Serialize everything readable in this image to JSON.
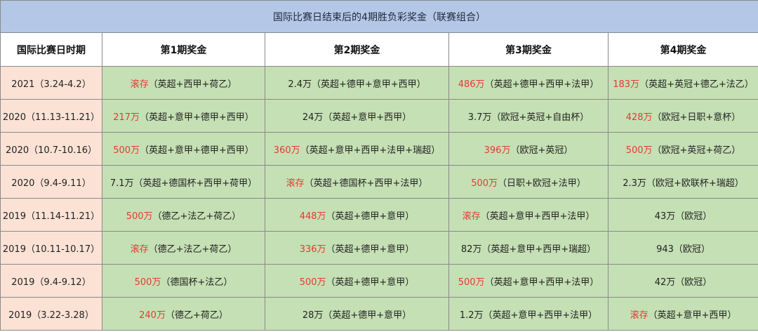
{
  "title": "国际比赛日结束后的4期胜负彩奖金（联赛组合）",
  "headers": [
    "国际比赛日时期",
    "第1期奖金",
    "第2期奖金",
    "第3期奖金",
    "第4期奖金"
  ],
  "highlight_color": "#e53935",
  "rows": [
    {
      "period": "2021（3.24-4.2）",
      "cells": [
        {
          "amount": "滚存",
          "highlight": true,
          "leagues": "（英超+西甲+荷乙）"
        },
        {
          "amount": "2.4万",
          "highlight": false,
          "leagues": "（英超+德甲+意甲+西甲）"
        },
        {
          "amount": "486万",
          "highlight": true,
          "leagues": "（英超+德甲+西甲+法甲）"
        },
        {
          "amount": "183万",
          "highlight": true,
          "leagues": "（英超+英冠+德乙+法乙）"
        }
      ]
    },
    {
      "period": "2020（11.13-11.21）",
      "cells": [
        {
          "amount": "217万",
          "highlight": true,
          "leagues": "（英超+意甲+德甲+西甲）"
        },
        {
          "amount": "24万",
          "highlight": false,
          "leagues": "（英超+意甲+西甲）"
        },
        {
          "amount": "3.7万",
          "highlight": false,
          "leagues": "（欧冠+英冠+自由杯）"
        },
        {
          "amount": "428万",
          "highlight": true,
          "leagues": "（欧冠+日职+意杯）"
        }
      ]
    },
    {
      "period": "2020（10.7-10.16）",
      "cells": [
        {
          "amount": "500万",
          "highlight": true,
          "leagues": "（英超+意甲+德甲+西甲）"
        },
        {
          "amount": "360万",
          "highlight": true,
          "leagues": "（英超+意甲+西甲+法甲+瑞超）"
        },
        {
          "amount": "396万",
          "highlight": true,
          "leagues": "（欧冠+英冠）"
        },
        {
          "amount": "500万",
          "highlight": true,
          "leagues": "（欧冠+英冠+荷乙）"
        }
      ]
    },
    {
      "period": "2020（9.4-9.11）",
      "cells": [
        {
          "amount": "7.1万",
          "highlight": false,
          "leagues": "（英超+德国杯+西甲+荷甲）"
        },
        {
          "amount": "滚存",
          "highlight": true,
          "leagues": "（英超+德国杯+西甲+法甲）"
        },
        {
          "amount": "500万",
          "highlight": true,
          "leagues": "（日职+欧冠+法甲）"
        },
        {
          "amount": "2.3万",
          "highlight": false,
          "leagues": "（欧冠+欧联杯+瑞超）"
        }
      ]
    },
    {
      "period": "2019（11.14-11.21）",
      "cells": [
        {
          "amount": "500万",
          "highlight": true,
          "leagues": "（德乙+法乙+荷乙）"
        },
        {
          "amount": "448万",
          "highlight": true,
          "leagues": "（英超+德甲+意甲）"
        },
        {
          "amount": "滚存",
          "highlight": true,
          "leagues": "（英超+意甲+西甲+法甲）"
        },
        {
          "amount": "43万",
          "highlight": false,
          "leagues": "（欧冠）"
        }
      ]
    },
    {
      "period": "2019（10.11-10.17）",
      "cells": [
        {
          "amount": "滚存",
          "highlight": true,
          "leagues": "（德乙+法乙+荷乙）"
        },
        {
          "amount": "336万",
          "highlight": true,
          "leagues": "（英超+德甲+意甲）"
        },
        {
          "amount": "82万",
          "highlight": false,
          "leagues": "（英超+意甲+西甲+瑞超）"
        },
        {
          "amount": "943",
          "highlight": false,
          "leagues": "（欧冠）"
        }
      ]
    },
    {
      "period": "2019（9.4-9.12）",
      "cells": [
        {
          "amount": "500万",
          "highlight": true,
          "leagues": "（德国杯+法乙）"
        },
        {
          "amount": "500万",
          "highlight": true,
          "leagues": "（英超+德甲+意甲）"
        },
        {
          "amount": "500万",
          "highlight": true,
          "leagues": "（英超+意甲+西甲+法甲）"
        },
        {
          "amount": "42万",
          "highlight": false,
          "leagues": "（欧冠）"
        }
      ]
    },
    {
      "period": "2019（3.22-3.28）",
      "cells": [
        {
          "amount": "240万",
          "highlight": true,
          "leagues": "（德乙+荷乙）"
        },
        {
          "amount": "28万",
          "highlight": false,
          "leagues": "（英超+德甲+意甲）"
        },
        {
          "amount": "1.2万",
          "highlight": false,
          "leagues": "（英超+意甲+西甲+法甲）"
        },
        {
          "amount": "滚存",
          "highlight": true,
          "leagues": "（英超+意甲+西甲）"
        }
      ]
    }
  ]
}
